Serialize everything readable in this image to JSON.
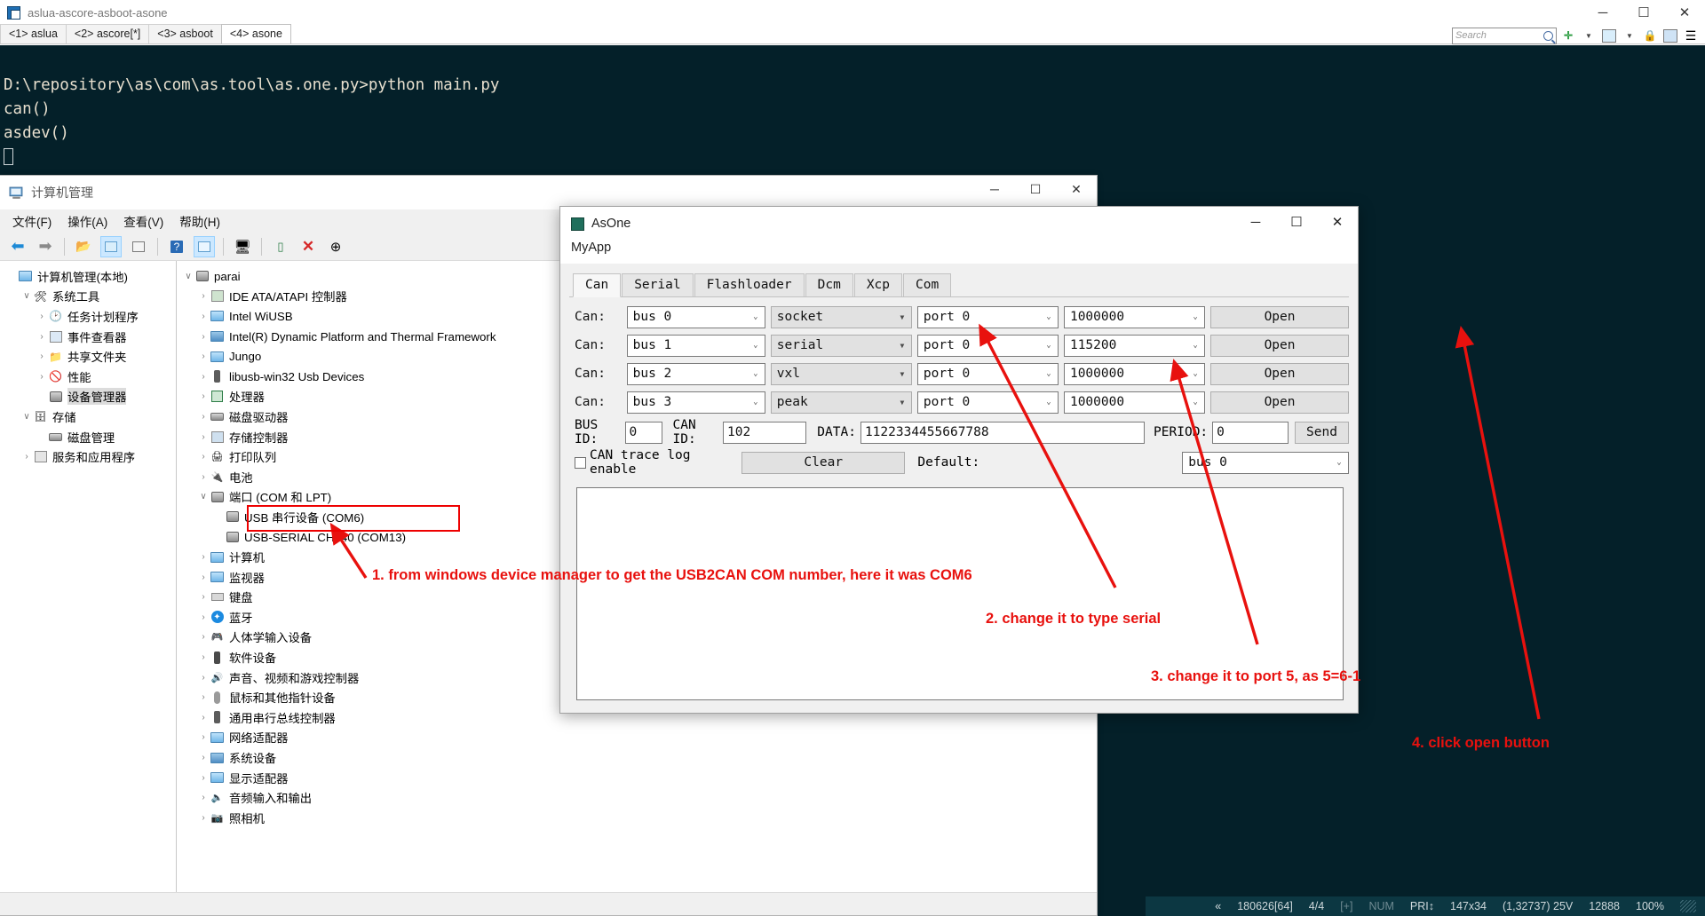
{
  "shell": {
    "title": "aslua-ascore-asboot-asone",
    "tabs": [
      {
        "label": "<1> aslua",
        "active": false
      },
      {
        "label": "<2> ascore[*]",
        "active": false
      },
      {
        "label": "<3> asboot",
        "active": false
      },
      {
        "label": "<4> asone",
        "active": true
      }
    ],
    "search_placeholder": "Search",
    "window_controls": {
      "minimize": "─",
      "maximize": "☐",
      "close": "✕"
    },
    "terminal_lines": [
      "D:\\repository\\as\\com\\as.tool\\as.one.py>python main.py",
      "can()",
      "asdev()"
    ],
    "status": {
      "marker": "«",
      "build": "180626[64]",
      "pages": "4/4",
      "plus": "[+]",
      "num": "NUM",
      "pri": "PRI↕",
      "size": "147x34",
      "coords": "(1,32737) 25V",
      "chars": "12888",
      "zoom": "100%"
    }
  },
  "computer_management": {
    "title": "计算机管理",
    "menu": [
      "文件(F)",
      "操作(A)",
      "查看(V)",
      "帮助(H)"
    ],
    "window_controls": {
      "minimize": "─",
      "maximize": "☐",
      "close": "✕"
    },
    "toolbar_icons": [
      "back-arrow",
      "forward-arrow",
      "up-folder",
      "show-hide-tree",
      "properties",
      "help",
      "show-console-tree",
      "scan-hardware",
      "update-driver",
      "uninstall-device",
      "download"
    ],
    "left_tree": [
      {
        "label": "计算机管理(本地)",
        "indent": 0,
        "expander": "",
        "icon": "monitor-icon"
      },
      {
        "label": "系统工具",
        "indent": 1,
        "expander": "∨",
        "icon": "tools-icon"
      },
      {
        "label": "任务计划程序",
        "indent": 2,
        "expander": "›",
        "icon": "clock-icon"
      },
      {
        "label": "事件查看器",
        "indent": 2,
        "expander": "›",
        "icon": "event-icon"
      },
      {
        "label": "共享文件夹",
        "indent": 2,
        "expander": "›",
        "icon": "folder-icon"
      },
      {
        "label": "性能",
        "indent": 2,
        "expander": "›",
        "icon": "performance-icon"
      },
      {
        "label": "设备管理器",
        "indent": 2,
        "expander": "",
        "icon": "device-manager-icon",
        "selected": true
      },
      {
        "label": "存储",
        "indent": 1,
        "expander": "∨",
        "icon": "storage-icon"
      },
      {
        "label": "磁盘管理",
        "indent": 2,
        "expander": "",
        "icon": "disk-icon"
      },
      {
        "label": "服务和应用程序",
        "indent": 1,
        "expander": "›",
        "icon": "services-icon"
      }
    ],
    "device_tree": [
      {
        "label": "parai",
        "indent": 0,
        "expander": "∨",
        "icon": "computer-icon"
      },
      {
        "label": "IDE ATA/ATAPI 控制器",
        "indent": 1,
        "expander": "›",
        "icon": "ide-icon"
      },
      {
        "label": "Intel WiUSB",
        "indent": 1,
        "expander": "›",
        "icon": "network-icon"
      },
      {
        "label": "Intel(R) Dynamic Platform and Thermal Framework",
        "indent": 1,
        "expander": "›",
        "icon": "system-icon"
      },
      {
        "label": "Jungo",
        "indent": 1,
        "expander": "›",
        "icon": "network-icon"
      },
      {
        "label": "libusb-win32 Usb Devices",
        "indent": 1,
        "expander": "›",
        "icon": "usb-icon"
      },
      {
        "label": "处理器",
        "indent": 1,
        "expander": "›",
        "icon": "cpu-icon"
      },
      {
        "label": "磁盘驱动器",
        "indent": 1,
        "expander": "›",
        "icon": "disk-icon"
      },
      {
        "label": "存储控制器",
        "indent": 1,
        "expander": "›",
        "icon": "storage-ctrl-icon"
      },
      {
        "label": "打印队列",
        "indent": 1,
        "expander": "›",
        "icon": "printer-icon"
      },
      {
        "label": "电池",
        "indent": 1,
        "expander": "›",
        "icon": "battery-icon"
      },
      {
        "label": "端口 (COM 和 LPT)",
        "indent": 1,
        "expander": "∨",
        "icon": "port-icon"
      },
      {
        "label": "USB 串行设备 (COM6)",
        "indent": 2,
        "expander": "",
        "icon": "port-icon",
        "highlighted": true
      },
      {
        "label": "USB-SERIAL CH340 (COM13)",
        "indent": 2,
        "expander": "",
        "icon": "port-icon"
      },
      {
        "label": "计算机",
        "indent": 1,
        "expander": "›",
        "icon": "monitor-icon"
      },
      {
        "label": "监视器",
        "indent": 1,
        "expander": "›",
        "icon": "monitor-icon"
      },
      {
        "label": "键盘",
        "indent": 1,
        "expander": "›",
        "icon": "keyboard-icon"
      },
      {
        "label": "蓝牙",
        "indent": 1,
        "expander": "›",
        "icon": "bluetooth-icon"
      },
      {
        "label": "人体学输入设备",
        "indent": 1,
        "expander": "›",
        "icon": "hid-icon"
      },
      {
        "label": "软件设备",
        "indent": 1,
        "expander": "›",
        "icon": "software-device-icon"
      },
      {
        "label": "声音、视频和游戏控制器",
        "indent": 1,
        "expander": "›",
        "icon": "speaker-icon"
      },
      {
        "label": "鼠标和其他指针设备",
        "indent": 1,
        "expander": "›",
        "icon": "mouse-icon"
      },
      {
        "label": "通用串行总线控制器",
        "indent": 1,
        "expander": "›",
        "icon": "usb-icon"
      },
      {
        "label": "网络适配器",
        "indent": 1,
        "expander": "›",
        "icon": "network-icon"
      },
      {
        "label": "系统设备",
        "indent": 1,
        "expander": "›",
        "icon": "system-icon"
      },
      {
        "label": "显示适配器",
        "indent": 1,
        "expander": "›",
        "icon": "display-icon"
      },
      {
        "label": "音频输入和输出",
        "indent": 1,
        "expander": "›",
        "icon": "audio-icon"
      },
      {
        "label": "照相机",
        "indent": 1,
        "expander": "›",
        "icon": "camera-icon"
      }
    ]
  },
  "asone": {
    "title": "AsOne",
    "subtitle": "MyApp",
    "window_controls": {
      "minimize": "─",
      "maximize": "☐",
      "close": "✕"
    },
    "tabs": [
      {
        "label": "Can",
        "active": true
      },
      {
        "label": "Serial",
        "active": false
      },
      {
        "label": "Flashloader",
        "active": false
      },
      {
        "label": "Dcm",
        "active": false
      },
      {
        "label": "Xcp",
        "active": false
      },
      {
        "label": "Com",
        "active": false
      }
    ],
    "can_rows": [
      {
        "label": "Can:",
        "bus": "bus 0",
        "driver": "socket",
        "port": "port 0",
        "baud": "1000000",
        "open": "Open"
      },
      {
        "label": "Can:",
        "bus": "bus 1",
        "driver": "serial",
        "port": "port 0",
        "baud": "115200",
        "open": "Open"
      },
      {
        "label": "Can:",
        "bus": "bus 2",
        "driver": "vxl",
        "port": "port 0",
        "baud": "1000000",
        "open": "Open"
      },
      {
        "label": "Can:",
        "bus": "bus 3",
        "driver": "peak",
        "port": "port 0",
        "baud": "1000000",
        "open": "Open"
      }
    ],
    "send_row": {
      "bus_id_label": "BUS ID:",
      "bus_id_value": "0",
      "can_id_label": "CAN ID:",
      "can_id_value": "102",
      "data_label": "DATA:",
      "data_value": "1122334455667788",
      "period_label": "PERIOD:",
      "period_value": "0",
      "send_label": "Send"
    },
    "options_row": {
      "trace_label": "CAN trace log enable",
      "trace_checked": false,
      "clear_label": "Clear",
      "default_label": "Default:",
      "default_value": "bus 0"
    }
  },
  "annotations": [
    {
      "id": 1,
      "text": "1. from windows device manager to get the USB2CAN COM number, here it was COM6"
    },
    {
      "id": 2,
      "text": "2. change it to type serial"
    },
    {
      "id": 3,
      "text": "3. change it to port 5, as 5=6-1"
    },
    {
      "id": 4,
      "text": "4. click open button"
    }
  ],
  "colors": {
    "annotation_red": "#e8110e",
    "terminal_bg": "#042029",
    "accent_blue": "#0078d7"
  }
}
